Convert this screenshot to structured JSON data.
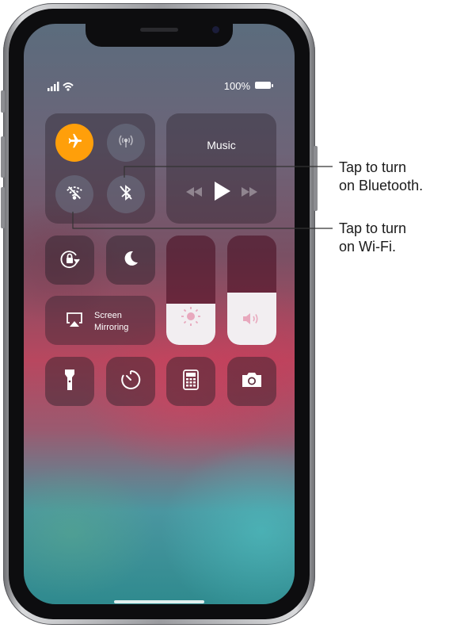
{
  "status_bar": {
    "battery_percent": "100%"
  },
  "control_center": {
    "connectivity": {
      "airplane_mode": {
        "icon": "airplane-icon",
        "on": true,
        "color": "#ff9f0a"
      },
      "cellular_data": {
        "icon": "antenna-icon",
        "on": false
      },
      "wifi": {
        "icon": "wifi-off-icon",
        "on": false
      },
      "bluetooth": {
        "icon": "bluetooth-off-icon",
        "on": false
      }
    },
    "music": {
      "title": "Music"
    },
    "orientation_lock": {
      "icon": "rotation-lock-icon"
    },
    "do_not_disturb": {
      "icon": "moon-icon"
    },
    "screen_mirroring": {
      "line1": "Screen",
      "line2": "Mirroring"
    },
    "brightness": {
      "icon": "sun-icon",
      "level": 0.38
    },
    "volume": {
      "icon": "speaker-icon",
      "level": 0.48
    },
    "shortcuts": [
      "flashlight-icon",
      "timer-icon",
      "calculator-icon",
      "camera-icon"
    ]
  },
  "callouts": {
    "bluetooth": {
      "line1": "Tap to turn",
      "line2": "on Bluetooth."
    },
    "wifi": {
      "line1": "Tap to turn",
      "line2": "on Wi-Fi."
    }
  }
}
